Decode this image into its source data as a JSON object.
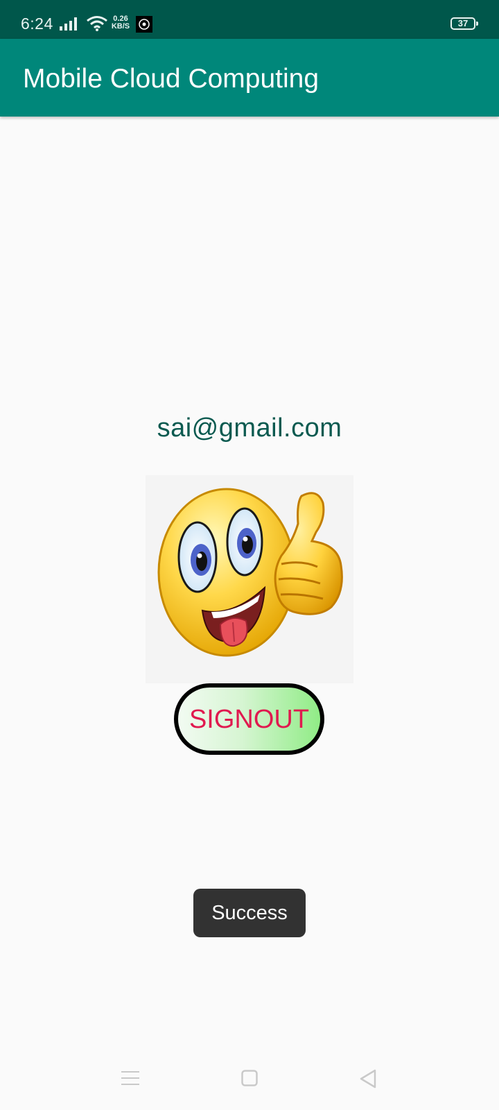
{
  "status_bar": {
    "time": "6:24",
    "net_speed_value": "0.26",
    "net_speed_unit": "KB/S",
    "battery_level": "37",
    "icons": [
      "signal-icon",
      "wifi-icon",
      "app-notification-icon",
      "battery-icon"
    ]
  },
  "app_bar": {
    "title": "Mobile Cloud Computing"
  },
  "main": {
    "email": "sai@gmail.com",
    "image": "emoji-thumbs-up",
    "signout_label": "SIGNOUT"
  },
  "toast": {
    "message": "Success"
  },
  "nav_bar": {
    "icons": [
      "menu-icon",
      "home-icon",
      "back-icon"
    ]
  },
  "colors": {
    "status_bar": "#00574b",
    "app_bar": "#00877a",
    "email_text": "#0b5a50",
    "signout_text": "#e0194f",
    "toast_bg": "#323232"
  }
}
